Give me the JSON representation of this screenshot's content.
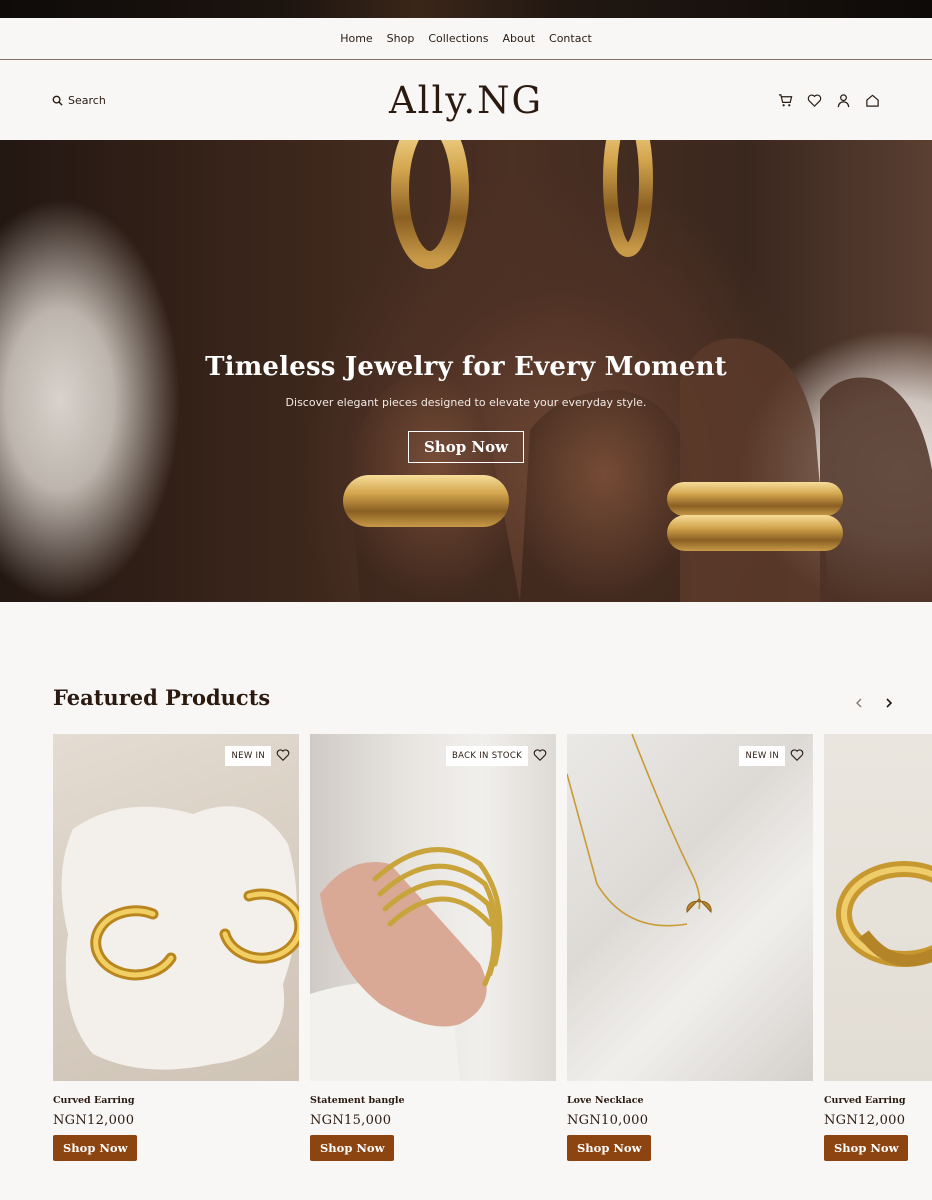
{
  "nav": {
    "items": [
      "Home",
      "Shop",
      "Collections",
      "About",
      "Contact"
    ]
  },
  "header": {
    "search_label": "Search",
    "logo": "Ally.NG",
    "icons": [
      "cart-icon",
      "heart-icon",
      "user-icon",
      "bag-icon"
    ]
  },
  "hero": {
    "title": "Timeless Jewelry for Every Moment",
    "subtitle": "Discover elegant pieces designed to elevate your everyday style.",
    "button": "Shop Now"
  },
  "featured": {
    "title": "Featured Products",
    "products": [
      {
        "badge": "NEW IN",
        "name": "Curved Earring",
        "price": "NGN12,000",
        "button": "Shop Now"
      },
      {
        "badge": "BACK IN STOCK",
        "name": "Statement bangle",
        "price": "NGN15,000",
        "button": "Shop Now"
      },
      {
        "badge": "NEW IN",
        "name": "Love Necklace",
        "price": "NGN10,000",
        "button": "Shop Now"
      },
      {
        "badge": "",
        "name": "Curved Earring",
        "price": "NGN12,000",
        "button": "Shop Now"
      }
    ]
  },
  "colors": {
    "accent": "#8c4510",
    "text": "#2b1a10",
    "background": "#f8f7f6"
  }
}
